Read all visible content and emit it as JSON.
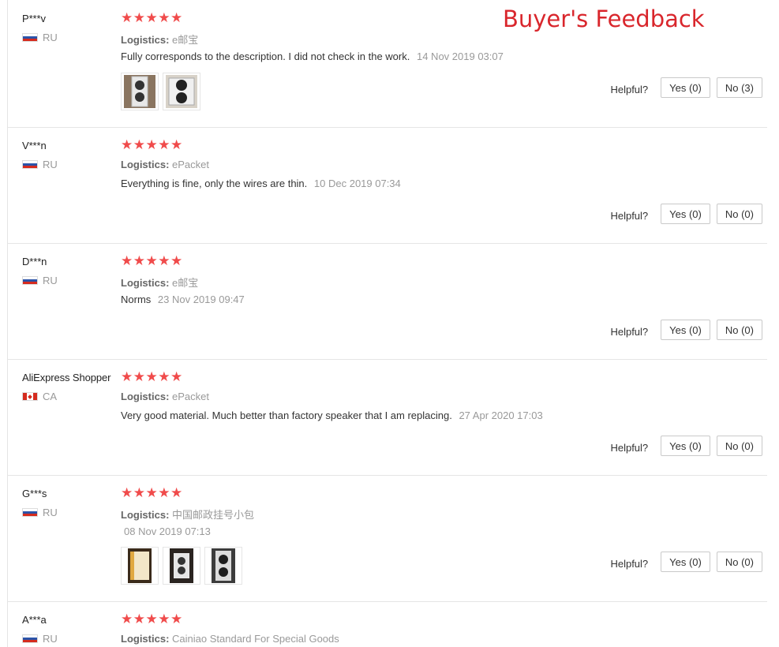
{
  "banner": "Buyer's Feedback",
  "helpful_label": "Helpful?",
  "reviews": [
    {
      "user": "P***v",
      "country": "RU",
      "rating_stars": "★★★★★",
      "logistics_label": "Logistics:",
      "logistics": "e邮宝",
      "comment": "Fully corresponds to the description. I did not check in the work.",
      "date": "14 Nov 2019 03:07",
      "yes_label": "Yes (0)",
      "no_label": "No (3)"
    },
    {
      "user": "V***n",
      "country": "RU",
      "rating_stars": "★★★★★",
      "logistics_label": "Logistics:",
      "logistics": "ePacket",
      "comment": "Everything is fine, only the wires are thin.",
      "date": "10 Dec 2019 07:34",
      "yes_label": "Yes (0)",
      "no_label": "No (0)"
    },
    {
      "user": "D***n",
      "country": "RU",
      "rating_stars": "★★★★★",
      "logistics_label": "Logistics:",
      "logistics": "e邮宝",
      "comment": "Norms",
      "date": "23 Nov 2019 09:47",
      "yes_label": "Yes (0)",
      "no_label": "No (0)"
    },
    {
      "user": "AliExpress Shopper",
      "country": "CA",
      "rating_stars": "★★★★★",
      "logistics_label": "Logistics:",
      "logistics": "ePacket",
      "comment": "Very good material. Much better than factory speaker that I am replacing.",
      "date": "27 Apr 2020 17:03",
      "yes_label": "Yes (0)",
      "no_label": "No (0)"
    },
    {
      "user": "G***s",
      "country": "RU",
      "rating_stars": "★★★★★",
      "logistics_label": "Logistics:",
      "logistics": "中国邮政挂号小包",
      "date": "08 Nov 2019 07:13",
      "yes_label": "Yes (0)",
      "no_label": "No (0)"
    },
    {
      "user": "A***a",
      "country": "RU",
      "rating_stars": "★★★★★",
      "logistics_label": "Logistics:",
      "logistics": "Cainiao Standard For Special Goods"
    }
  ]
}
